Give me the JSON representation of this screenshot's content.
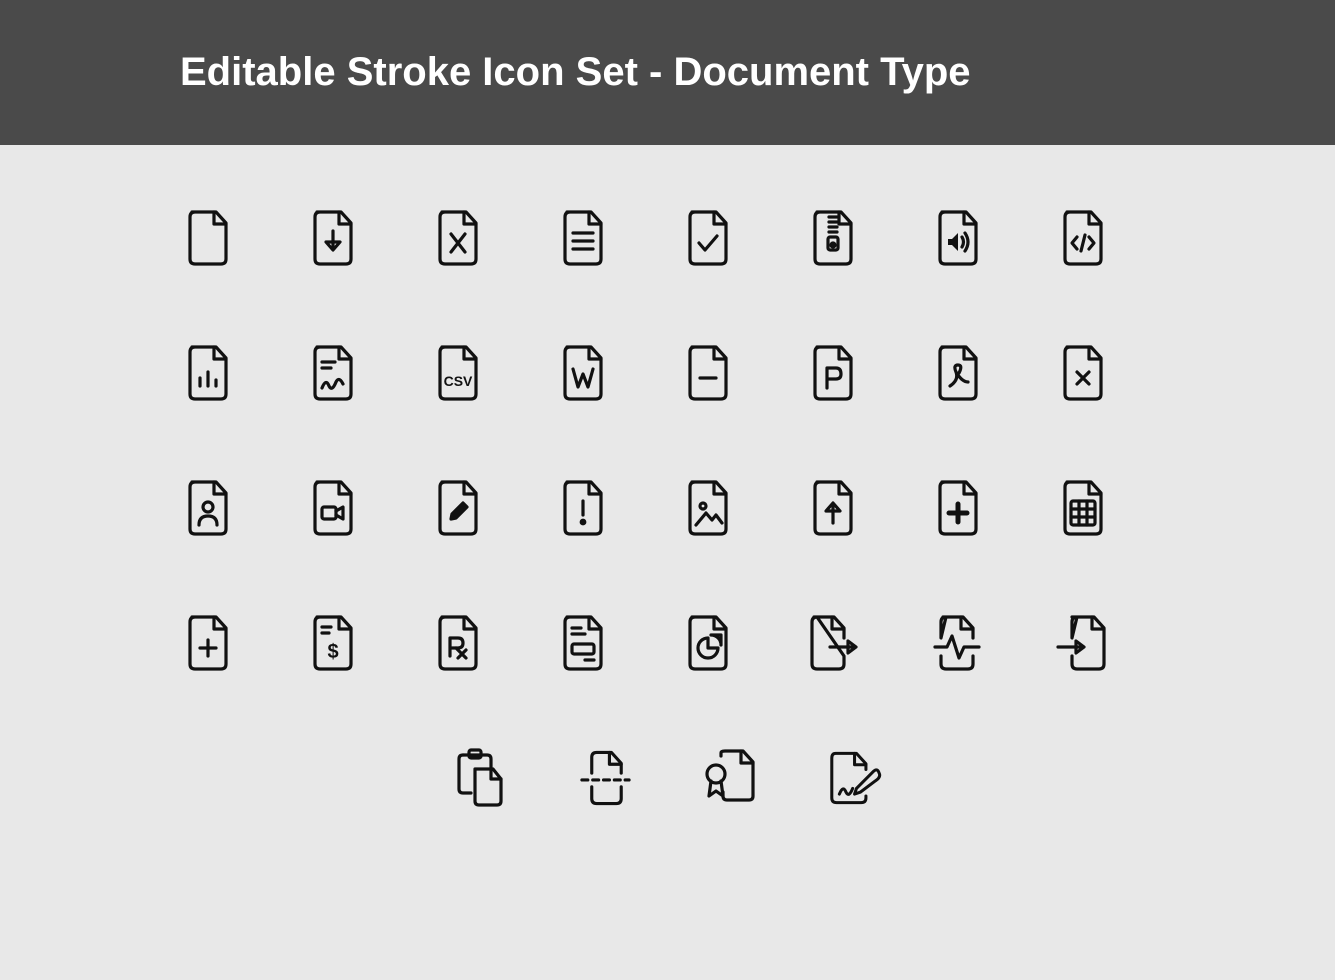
{
  "header": {
    "title": "Editable Stroke Icon Set - Document Type"
  },
  "icons": {
    "row1": [
      "file-blank",
      "file-download",
      "file-excel",
      "file-text",
      "file-check",
      "file-zip",
      "file-audio",
      "file-code"
    ],
    "row2": [
      "file-chart-bar",
      "file-signature",
      "file-csv",
      "file-word",
      "file-minus",
      "file-powerpoint",
      "file-pdf",
      "file-remove"
    ],
    "row3": [
      "file-user",
      "file-video",
      "file-edit",
      "file-alert",
      "file-image",
      "file-upload",
      "file-medical",
      "file-spreadsheet"
    ],
    "row4": [
      "file-add",
      "file-invoice",
      "file-prescription",
      "file-form",
      "file-pie",
      "file-export",
      "file-activity",
      "file-import"
    ],
    "row5": [
      "file-clipboard",
      "file-break",
      "file-certificate",
      "file-sign"
    ]
  },
  "style": {
    "stroke": "#111",
    "strokeWidth": 3.2
  }
}
